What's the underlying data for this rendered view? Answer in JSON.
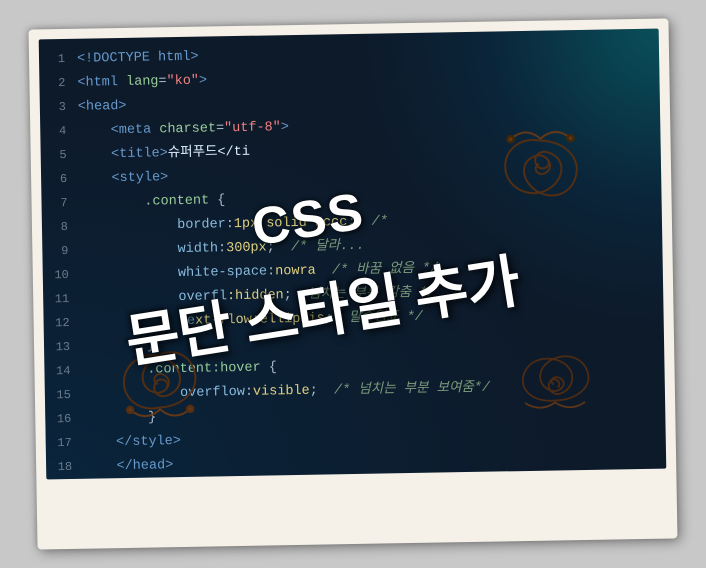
{
  "photo": {
    "lines": [
      {
        "num": "1",
        "html": "<span class='tag'>&lt;!DOCTYPE html&gt;</span>"
      },
      {
        "num": "2",
        "html": "<span class='tag'>&lt;html</span> <span class='attr'>lang</span><span class='punct'>=</span><span class='val'>\"ko\"</span><span class='tag'>&gt;</span>"
      },
      {
        "num": "3",
        "html": "<span class='tag'>&lt;head&gt;</span>"
      },
      {
        "num": "4",
        "html": "    <span class='tag'>&lt;meta</span> <span class='attr'>charset</span><span class='punct'>=</span><span class='val'>\"utf-8\"</span><span class='tag'>&gt;</span>"
      },
      {
        "num": "5",
        "html": "    <span class='tag'>&lt;title&gt;</span><span class='text-content'>슈퍼푸드&lt;/ti</span>"
      },
      {
        "num": "6",
        "html": "    <span class='tag'>&lt;style&gt;</span>"
      },
      {
        "num": "7",
        "html": "        <span class='selector'>.content</span> <span class='punct'>{</span>"
      },
      {
        "num": "8",
        "html": "            <span class='prop'>border</span><span class='punct'>:</span><span class='propval'>1px so</span><span class='propval'>lid #ccc</span><span class='comment'>;  /*</span>"
      },
      {
        "num": "9",
        "html": "            <span class='prop'>width</span><span class='punct'>:</span><span class='propval'>300px</span><span class='punct'>;</span>  <span class='comment'>/* 달라...</span>"
      },
      {
        "num": "10",
        "html": "            <span class='prop'>white-space</span><span class='punct'>:</span><span class='propval'>nowra</span>  <span class='comment'>/* 바꿈 없음 */</span>"
      },
      {
        "num": "11",
        "html": "            <span class='prop'>overfl</span><span class='propval'>:hidden</span><span class='punct'>;</span>  <span class='comment'>넘치는 부분 감춤 */</span>"
      },
      {
        "num": "12",
        "html": "            <span class='prop'>te</span><span class='propval'>xt-flow:ellipsis</span><span class='comment'>;  말줄임표 */</span>"
      },
      {
        "num": "13",
        "html": "        <span class='punct'>}</span>"
      },
      {
        "num": "14",
        "html": "        <span class='selector'>.content:hover</span> <span class='punct'>{</span>"
      },
      {
        "num": "15",
        "html": "            <span class='prop'>overflow</span><span class='punct'>:</span><span class='propval'>visible</span><span class='punct'>;</span>  <span class='comment'>/* 넘치는 부분 보여줌*/</span>"
      },
      {
        "num": "16",
        "html": "        <span class='punct'>}</span>"
      },
      {
        "num": "17",
        "html": "    <span class='tag'>&lt;/style&gt;</span>"
      },
      {
        "num": "18",
        "html": "    <span class='tag'>&lt;/head&gt;</span>"
      }
    ],
    "overlay_css": "CSS",
    "overlay_korean": "문단 스타일 추가"
  }
}
